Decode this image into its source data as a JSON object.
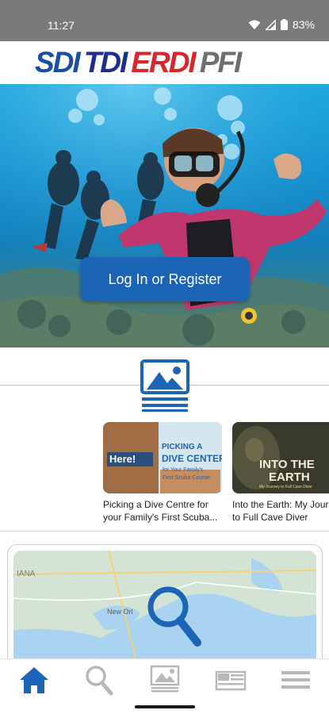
{
  "status_bar": {
    "time": "11:27",
    "battery": "83%"
  },
  "logo": {
    "brands": [
      "SDI",
      "TDI",
      "ERDI",
      "PFI"
    ]
  },
  "hero": {
    "login_label": "Log In or Register"
  },
  "gallery": {
    "cards": [
      {
        "title": "Picking a Dive Centre for your Family's First Scuba...",
        "thumb_text_1": "PICKING A",
        "thumb_text_2": "DIVE CENTER",
        "thumb_text_3": "for Your Family's",
        "thumb_text_4": "First Scuba Course",
        "thumb_sign": "Here!"
      },
      {
        "title": "Into the Earth: My Journey to Full Cave Diver",
        "thumb_text_1": "INTO THE",
        "thumb_text_2": "EARTH",
        "thumb_text_3": "My Journey to Full Cave Diver"
      }
    ]
  },
  "map": {
    "labels": [
      "IANA",
      "New Orl"
    ]
  },
  "nav": {
    "items": [
      "home-icon",
      "search-icon",
      "gallery-icon",
      "flag-icon",
      "menu-icon"
    ],
    "active_color": "#1c64b6",
    "inactive_color": "#b8b8b8"
  },
  "colors": {
    "brand_blue": "#1c64b6",
    "status_bar": "#7a7a7a"
  }
}
